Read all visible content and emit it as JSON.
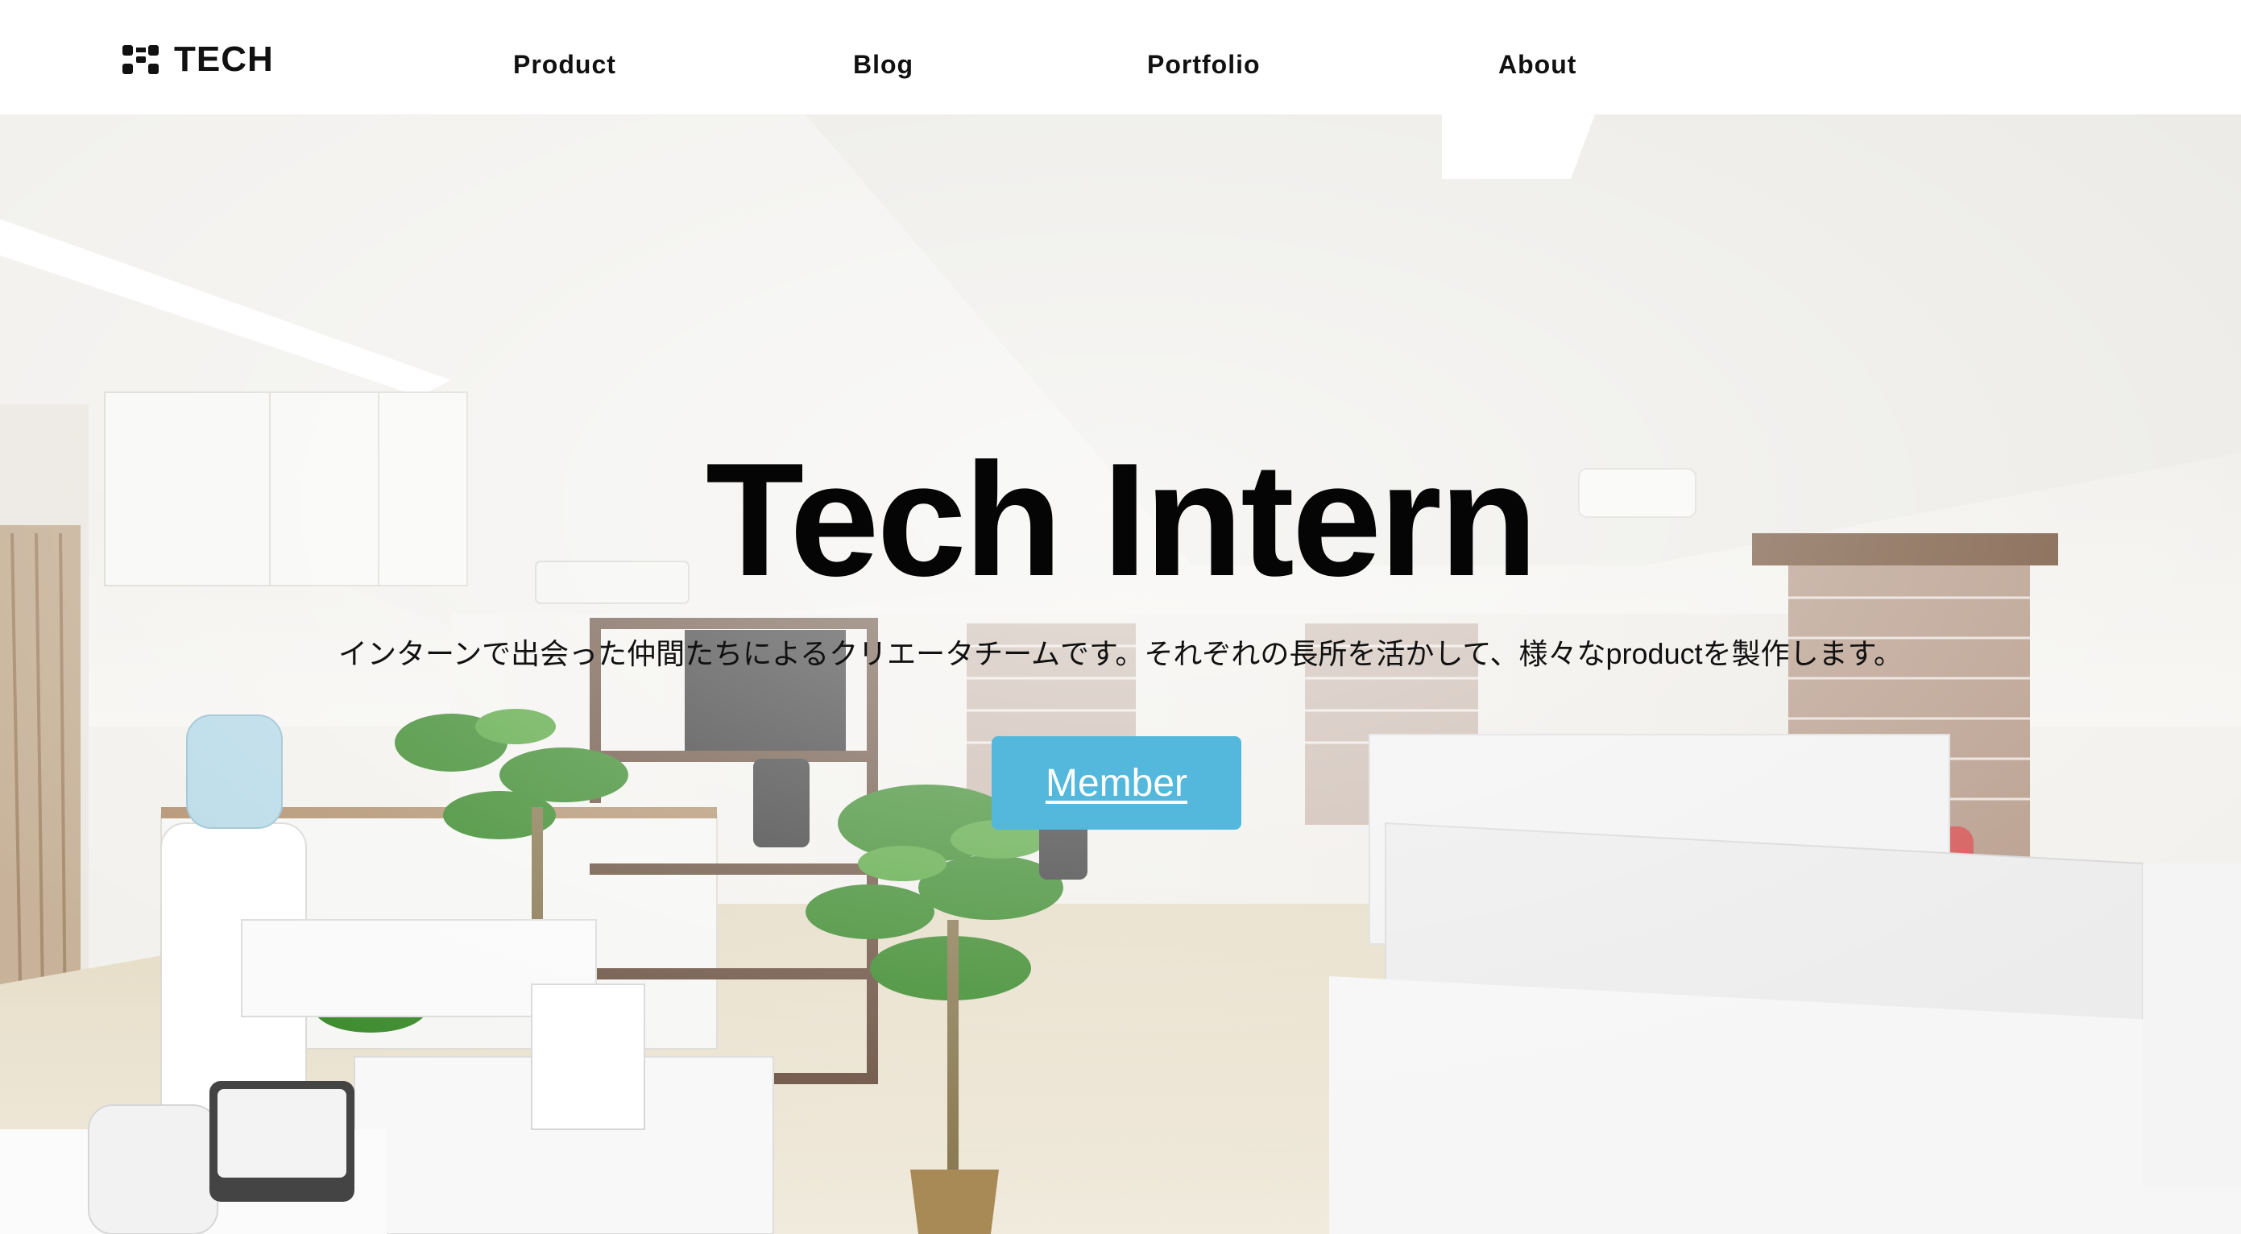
{
  "header": {
    "logo_text": "TECH",
    "nav": {
      "product": "Product",
      "blog": "Blog",
      "portfolio": "Portfolio",
      "about": "About"
    }
  },
  "hero": {
    "title": "Tech Intern",
    "subtitle": "インターンで出会った仲間たちによるクリエータチームです。それぞれの長所を活かして、様々なproductを製作します。",
    "button_label": "Member",
    "button_color": "#53b8dc",
    "background_image": "office-interior-photo"
  },
  "colors": {
    "header_bg": "#ffffff",
    "text": "#111111"
  }
}
